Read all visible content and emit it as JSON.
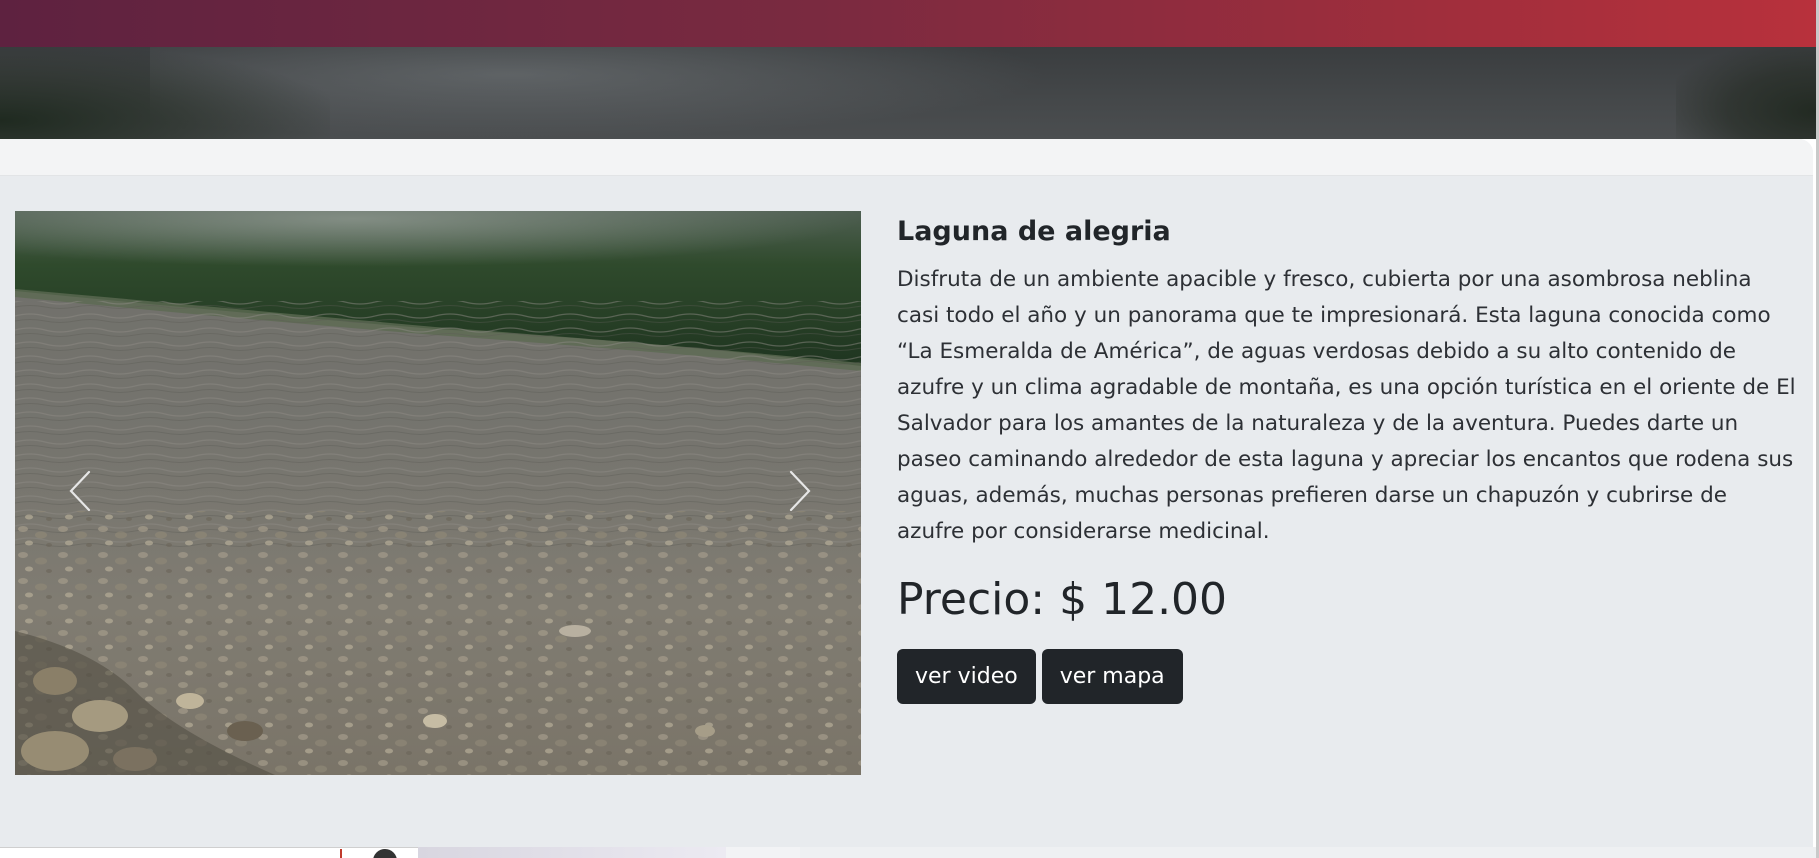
{
  "attraction": {
    "title": "Laguna de alegria",
    "description": "Disfruta de un ambiente apacible y fresco, cubierta por una asombrosa neblina casi todo el año y un panorama que te impresionará. Esta laguna conocida como “La Esmeralda de América”, de aguas verdosas debido a su alto contenido de azufre y un clima agradable de montaña, es una opción turística en el oriente de El Salvador para los amantes de la naturaleza y de la aventura. Puedes darte un paseo caminando alrededor de esta laguna y apreciar los encantos que rodena sus aguas, además, muchas personas prefieren darse un chapuzón y cubrirse de azufre por considerarse medicinal.",
    "price": "Precio: $ 12.00"
  },
  "buttons": {
    "video_label": "ver video",
    "map_label": "ver mapa"
  },
  "carousel": {
    "prev_icon": "chevron-left-icon",
    "next_icon": "chevron-right-icon"
  },
  "colors": {
    "header_gradient_start": "#5e2240",
    "header_gradient_end": "#b8313c",
    "button_bg": "#212529",
    "card_bg": "#e8ebee"
  }
}
